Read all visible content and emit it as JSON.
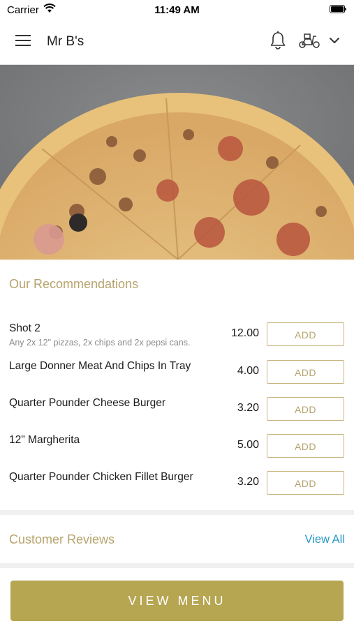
{
  "status_bar": {
    "carrier": "Carrier",
    "time": "11:49 AM",
    "icons": [
      "wifi-icon",
      "battery-icon"
    ]
  },
  "header": {
    "title": "Mr B's",
    "icons": [
      "hamburger-menu-icon",
      "bell-icon",
      "scooter-icon",
      "chevron-down-icon"
    ]
  },
  "hero": {
    "image_subject": "pizza-image"
  },
  "recommendations": {
    "title": "Our Recommendations",
    "items": [
      {
        "name": "Shot 2",
        "description": "Any 2x 12\" pizzas, 2x chips and 2x pepsi cans.",
        "price": "12.00",
        "button": "ADD"
      },
      {
        "name": "Large Donner Meat And Chips In Tray",
        "description": "",
        "price": "4.00",
        "button": "ADD"
      },
      {
        "name": "Quarter Pounder Cheese Burger",
        "description": "",
        "price": "3.20",
        "button": "ADD"
      },
      {
        "name": "12\" Margherita",
        "description": "",
        "price": "5.00",
        "button": "ADD"
      },
      {
        "name": "Quarter Pounder Chicken Fillet Burger",
        "description": "",
        "price": "3.20",
        "button": "ADD"
      }
    ]
  },
  "reviews": {
    "title": "Customer Reviews",
    "view_all": "View All"
  },
  "footer": {
    "button": "VIEW MENU"
  },
  "colors": {
    "accent_gold": "#b6a36c",
    "button_gold": "#b6a551",
    "link_blue": "#2c9ac7",
    "divider_grey": "#f0f0f0"
  }
}
